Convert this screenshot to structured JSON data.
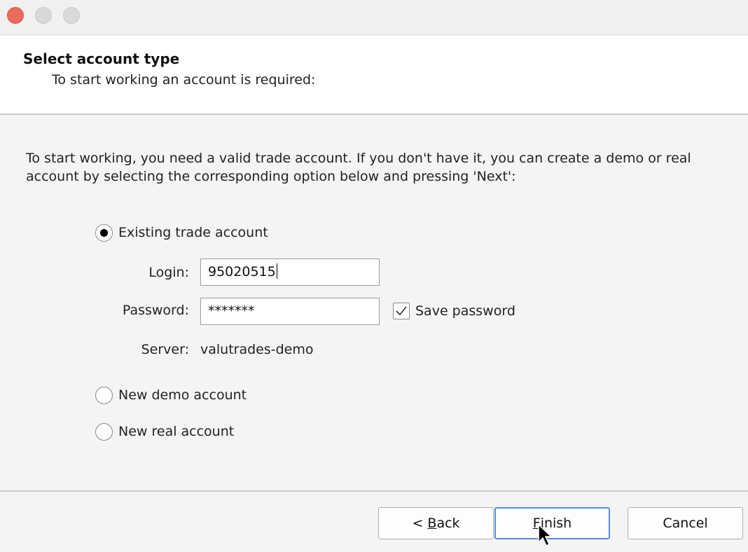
{
  "window": {
    "controls": [
      "close",
      "minimize",
      "maximize"
    ]
  },
  "header": {
    "title": "Select account type",
    "subtitle": "To start working an account is required:"
  },
  "intro": "To start working, you need a valid trade account. If you don't have it, you can create a demo or real account by selecting the corresponding option below and pressing 'Next':",
  "options": {
    "existing": {
      "label": "Existing trade account",
      "selected": true
    },
    "demo": {
      "label": "New demo account",
      "selected": false
    },
    "real": {
      "label": "New real account",
      "selected": false
    }
  },
  "form": {
    "login_label": "Login:",
    "login_value": "95020515",
    "password_label": "Password:",
    "password_value": "*******",
    "save_password_label": "Save password",
    "save_password_checked": true,
    "server_label": "Server:",
    "server_value": "valutrades-demo"
  },
  "buttons": {
    "back_prefix": "< ",
    "back_mnemonic": "B",
    "back_rest": "ack",
    "finish_mnemonic": "F",
    "finish_rest": "inish",
    "cancel": "Cancel"
  }
}
